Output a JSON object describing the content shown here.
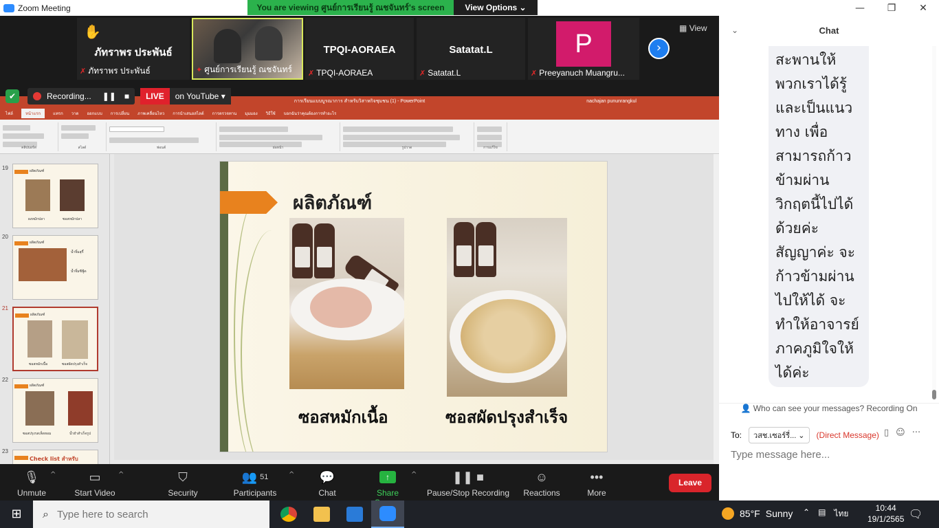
{
  "window": {
    "title": "Zoom Meeting",
    "viewing_banner": "You are viewing ศูนย์การเรียนรู้ ณชจันทร์'s screen",
    "view_options": "View Options ⌄",
    "controls": [
      "—",
      "❐",
      "✕"
    ]
  },
  "gallery": {
    "tiles": [
      {
        "big_name": "ภัทราพร ประพันธ์",
        "small_name": "ภัทราพร ประพันธ์",
        "raised_hand": true
      },
      {
        "big_name": "",
        "small_name": "ศูนย์การเรียนรู้ ณชจันทร์",
        "video": true
      },
      {
        "big_name": "TPQI-AORAEA",
        "small_name": "TPQI-AORAEA"
      },
      {
        "big_name": "Satatat.L",
        "small_name": "Satatat.L"
      },
      {
        "big_name": "",
        "small_name": "Preeyanuch Muangru...",
        "avatar_letter": "P",
        "avatar_color": "#d21b6b"
      }
    ],
    "next_icon": "›",
    "view_label": "View"
  },
  "recording": {
    "label": "Recording...",
    "live": "LIVE",
    "platform": "on YouTube ▾"
  },
  "ppt": {
    "title": "การเรียนแบบบูรณาการ สำหรับวิสาหกิจชุมชน (1) - PowerPoint",
    "user": "nachajan pununrangkul",
    "tabs": [
      "ไฟล์",
      "หน้าแรก",
      "แทรก",
      "วาด",
      "ออกแบบ",
      "การเปลี่ยน",
      "ภาพเคลื่อนไหว",
      "การนำเสนอสไลด์",
      "การตรวจทาน",
      "มุมมอง",
      "วิธีใช้",
      "บอกฉันว่าคุณต้องการทำอะไร"
    ],
    "ribbon_groups": [
      "คลิปบอร์ด",
      "สไลด์",
      "ฟอนต์",
      "ย่อหน้า",
      "รูปวาด",
      "การแก้ไข"
    ],
    "thumbnails": [
      {
        "num": "19",
        "title": "ผลิตภัณฑ์",
        "captions": [
          "ผงหมักปลา",
          "ซอสหมักปลา"
        ]
      },
      {
        "num": "20",
        "title": "ผลิตภัณฑ์",
        "captions": [
          "น้ำจิ้มสุกี้",
          "น้ำจิ้มซีฟู้ด"
        ]
      },
      {
        "num": "21",
        "title": "ผลิตภัณฑ์",
        "captions": [
          "ซอสหมักเนื้อ",
          "ซอสผัดปรุงสำเร็จ"
        ],
        "selected": true
      },
      {
        "num": "22",
        "title": "ผลิตภัณฑ์",
        "captions": [
          "ซอสปรุงรสเห็ดหอม",
          "น้ำยำสำเร็จรูป"
        ]
      },
      {
        "num": "23",
        "title": "Check list สำหรับ"
      }
    ],
    "slide": {
      "title": "ผลิตภัณฑ์",
      "captions": [
        "ซอสหมักเนื้อ",
        "ซอสผัดปรุงสำเร็จ"
      ]
    }
  },
  "toolbar": {
    "unmute": "Unmute",
    "start_video": "Start Video",
    "security": "Security",
    "participants": "Participants",
    "participants_count": "51",
    "chat": "Chat",
    "share_screen": "Share Screen",
    "pause_stop": "Pause/Stop Recording",
    "reactions": "Reactions",
    "more": "More",
    "leave": "Leave"
  },
  "chat": {
    "header": "Chat",
    "message_lines": [
      "สะพานให้",
      "พวกเราได้รู้",
      "และเป็นแนว",
      "ทาง เพื่อ",
      "สามารถก้าว",
      "ข้ามผ่าน",
      "วิกฤตนี้ไปได้",
      "ด้วยค่ะ",
      "สัญญาค่ะ จะ",
      "ก้าวข้ามผ่าน",
      "ไปให้ได้ จะ",
      "ทำให้อาจารย์",
      "ภาคภูมิใจให้",
      "ได้ค่ะ"
    ],
    "who_can_see": "Who can see your messages? Recording On",
    "to_label": "To:",
    "recipient": "วสช.เซอร์รี่...",
    "direct": "(Direct Message)",
    "input_placeholder": "Type message here..."
  },
  "taskbar": {
    "search_placeholder": "Type here to search",
    "weather_temp": "85°F",
    "weather_cond": "Sunny",
    "lang": "ไทย",
    "time": "10:44",
    "date": "19/1/2565"
  }
}
